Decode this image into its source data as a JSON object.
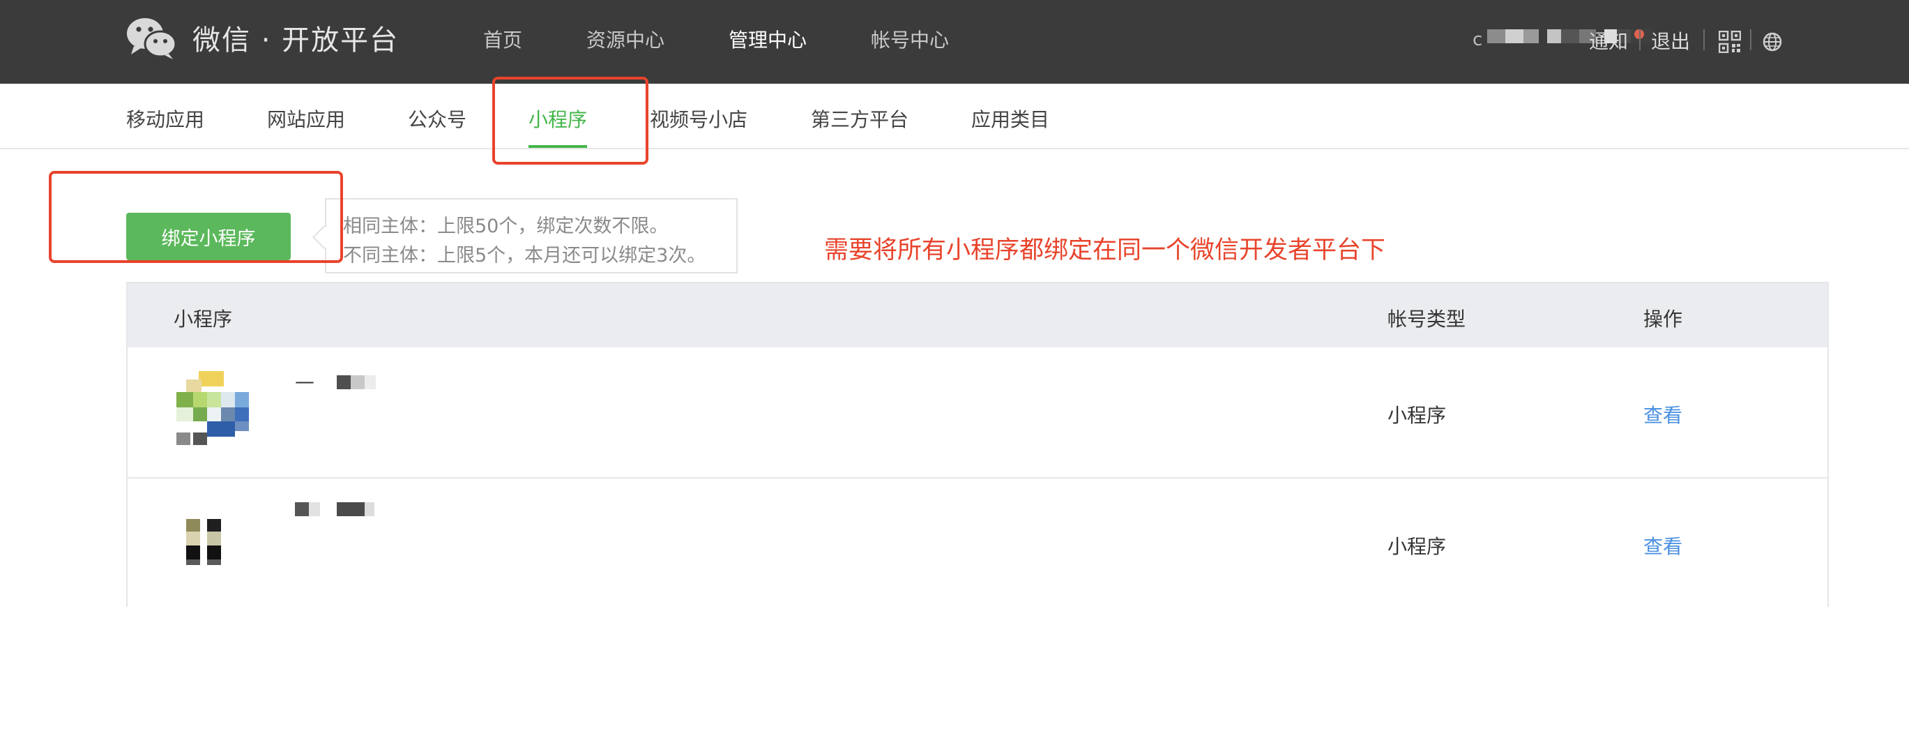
{
  "colors": {
    "accent": "#44b549",
    "link": "#4a90e2",
    "annotation": "#e8442c",
    "header_bg": "#3b3b3b"
  },
  "header": {
    "logo_text": "微信 · 开放平台",
    "nav": [
      "首页",
      "资源中心",
      "管理中心",
      "帐号中心"
    ],
    "active_nav": "管理中心",
    "user_prefix": "c",
    "notice": "通知",
    "logout": "退出",
    "icons": [
      "qrcode-icon",
      "globe-icon"
    ]
  },
  "subnav": {
    "tabs": [
      "移动应用",
      "网站应用",
      "公众号",
      "小程序",
      "视频号小店",
      "第三方平台",
      "应用类目"
    ],
    "active": "小程序"
  },
  "bind": {
    "button": "绑定小程序",
    "tip_same": "相同主体：上限50个，绑定次数不限。",
    "tip_diff": "不同主体：上限5个，本月还可以绑定3次。"
  },
  "annotation": "需要将所有小程序都绑定在同一个微信开发者平台下",
  "table": {
    "headers": {
      "name": "小程序",
      "type": "帐号类型",
      "action": "操作"
    },
    "rows": [
      {
        "name_fragment": "—",
        "type": "小程序",
        "action": "查看"
      },
      {
        "name_fragment": "",
        "type": "小程序",
        "action": "查看"
      }
    ]
  }
}
